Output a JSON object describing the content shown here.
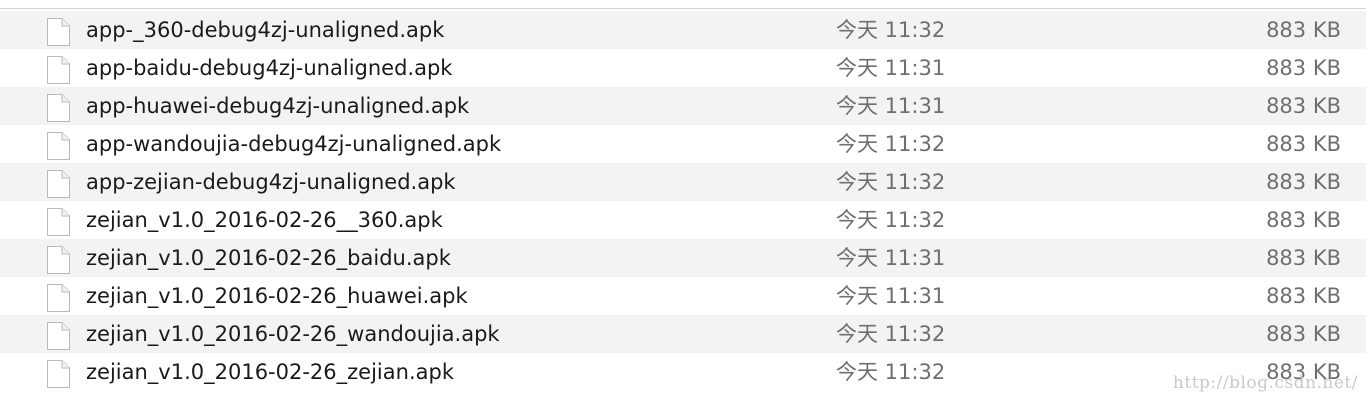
{
  "files": [
    {
      "name": "app-_360-debug4zj-unaligned.apk",
      "date": "今天 11:32",
      "size": "883 KB",
      "icon": "document-icon"
    },
    {
      "name": "app-baidu-debug4zj-unaligned.apk",
      "date": "今天 11:31",
      "size": "883 KB",
      "icon": "document-icon"
    },
    {
      "name": "app-huawei-debug4zj-unaligned.apk",
      "date": "今天 11:31",
      "size": "883 KB",
      "icon": "document-icon"
    },
    {
      "name": "app-wandoujia-debug4zj-unaligned.apk",
      "date": "今天 11:32",
      "size": "883 KB",
      "icon": "document-icon"
    },
    {
      "name": "app-zejian-debug4zj-unaligned.apk",
      "date": "今天 11:32",
      "size": "883 KB",
      "icon": "document-icon"
    },
    {
      "name": "zejian_v1.0_2016-02-26__360.apk",
      "date": "今天 11:32",
      "size": "883 KB",
      "icon": "document-icon"
    },
    {
      "name": "zejian_v1.0_2016-02-26_baidu.apk",
      "date": "今天 11:31",
      "size": "883 KB",
      "icon": "document-icon"
    },
    {
      "name": "zejian_v1.0_2016-02-26_huawei.apk",
      "date": "今天 11:31",
      "size": "883 KB",
      "icon": "document-icon"
    },
    {
      "name": "zejian_v1.0_2016-02-26_wandoujia.apk",
      "date": "今天 11:32",
      "size": "883 KB",
      "icon": "document-icon"
    },
    {
      "name": "zejian_v1.0_2016-02-26_zejian.apk",
      "date": "今天 11:32",
      "size": "883 KB",
      "icon": "document-icon"
    }
  ],
  "watermark": "http://blog.csdn.net/",
  "colors": {
    "row_stripe": "#f3f3f3",
    "row_plain": "#ffffff",
    "name_text": "#1a1a1a",
    "meta_text": "#6f6f6f"
  }
}
